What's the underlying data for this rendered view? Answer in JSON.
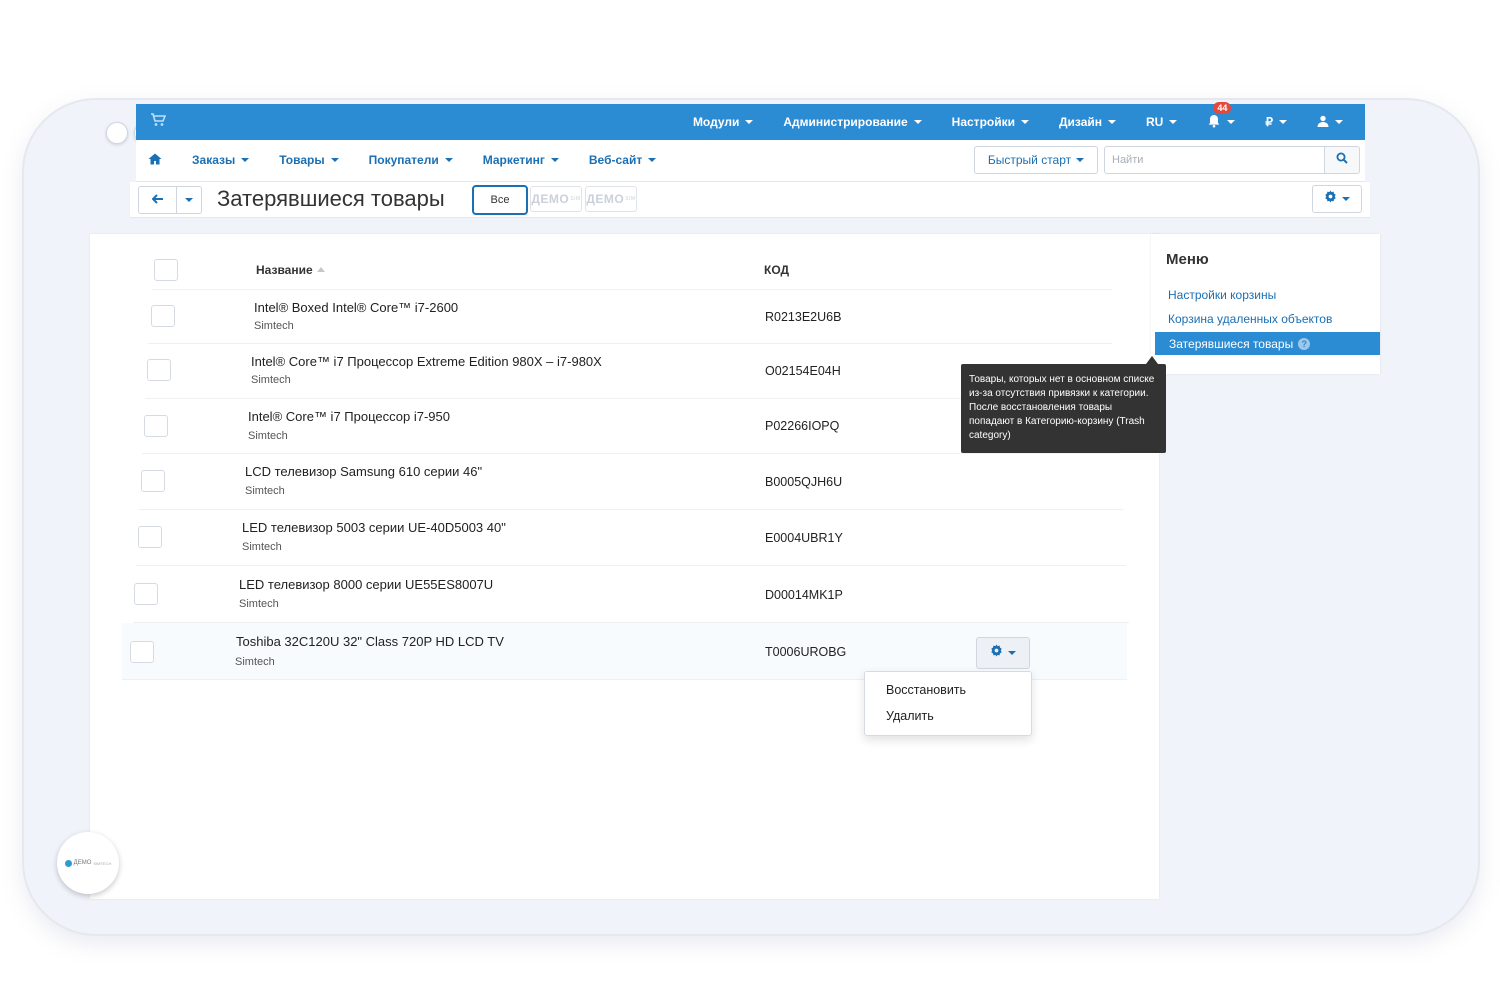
{
  "topbar": {
    "menu": [
      {
        "label": "Модули"
      },
      {
        "label": "Администрирование"
      },
      {
        "label": "Настройки"
      },
      {
        "label": "Дизайн"
      },
      {
        "label": "RU"
      }
    ],
    "notifications_count": "44",
    "currency": "₽"
  },
  "secnav": {
    "items": [
      {
        "label": "Заказы"
      },
      {
        "label": "Товары"
      },
      {
        "label": "Покупатели"
      },
      {
        "label": "Маркетинг"
      },
      {
        "label": "Веб-сайт"
      }
    ],
    "quick_start": "Быстрый старт",
    "search_placeholder": "Найти"
  },
  "page": {
    "title": "Затерявшиеся товары",
    "tab_all": "Все",
    "demo_chip": "ДЕМО",
    "demo_chip_sup": "SIM"
  },
  "table": {
    "col_name": "Название",
    "col_code": "КОД",
    "rows": [
      {
        "name": "Intel® Boxed Intel® Core™ i7-2600",
        "vendor": "Simtech",
        "code": "R0213E2U6B"
      },
      {
        "name": "Intel® Core™ i7 Процессор Extreme Edition 980X – i7-980X",
        "vendor": "Simtech",
        "code": "O02154E04H"
      },
      {
        "name": "Intel® Core™ i7 Процессор i7-950",
        "vendor": "Simtech",
        "code": "P02266IOPQ"
      },
      {
        "name": "LCD телевизор Samsung 610 серии 46\"",
        "vendor": "Simtech",
        "code": "B0005QJH6U"
      },
      {
        "name": "LED телевизор 5003 серии UE-40D5003 40\"",
        "vendor": "Simtech",
        "code": "E0004UBR1Y"
      },
      {
        "name": "LED телевизор 8000 серии UE55ES8007U",
        "vendor": "Simtech",
        "code": "D00014MK1P"
      },
      {
        "name": "Toshiba 32C120U 32\" Class 720P HD LCD TV",
        "vendor": "Simtech",
        "code": "T0006UROBG"
      }
    ]
  },
  "row_menu": {
    "restore": "Восстановить",
    "delete": "Удалить"
  },
  "tooltip": {
    "text": "Товары, которых нет в основном списке из-за отсутствия привязки к категории. После восстановления товары попадают в Категорию-корзину (Trash category)"
  },
  "sidebar": {
    "title": "Меню",
    "links": [
      {
        "label": "Настройки корзины"
      },
      {
        "label": "Корзина удаленных объектов"
      }
    ],
    "active": "Затерявшиеся товары"
  },
  "logo": {
    "text": "ДЕМО",
    "sub": "SIMTECH"
  },
  "colors": {
    "accent": "#2b8bd3",
    "link": "#1b6fb3",
    "badge": "#e8483b",
    "tooltip_bg": "#333333"
  }
}
